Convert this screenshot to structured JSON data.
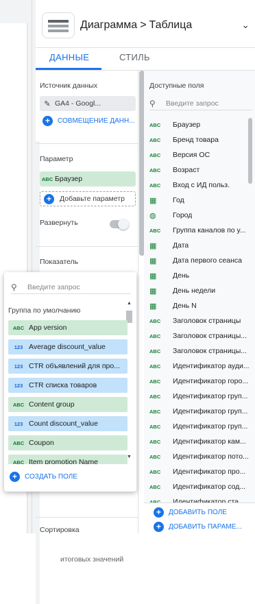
{
  "header": {
    "chart_type": "Диаграмма",
    "separator": ">",
    "chart_subtype": "Таблица"
  },
  "tabs": [
    {
      "label": "ДАННЫЕ",
      "active": true
    },
    {
      "label": "СТИЛЬ",
      "active": false
    }
  ],
  "data_panel": {
    "source_title": "Источник данных",
    "source_name": "GA4 - Googl...",
    "blend_label": "СОВМЕЩЕНИЕ ДАНН...",
    "param_title": "Параметр",
    "param_chip": "Браузер",
    "add_param": "Добавьте параметр",
    "expand_label": "Развернуть",
    "metric_title": "Показатель",
    "totals_label": "итоговых значений",
    "sort_title": "Сортировка"
  },
  "available_fields": {
    "title": "Доступные поля",
    "search_placeholder": "Введите запрос",
    "items": [
      {
        "type": "ABC",
        "label": "Браузер"
      },
      {
        "type": "ABC",
        "label": "Бренд товара"
      },
      {
        "type": "ABC",
        "label": "Версия ОС"
      },
      {
        "type": "ABC",
        "label": "Возраст"
      },
      {
        "type": "ABC",
        "label": "Вход с ИД польз."
      },
      {
        "type": "calendar",
        "label": "Год"
      },
      {
        "type": "globe",
        "label": "Город"
      },
      {
        "type": "ABC",
        "label": "Группа каналов по у..."
      },
      {
        "type": "calendar",
        "label": "Дата"
      },
      {
        "type": "calendar",
        "label": "Дата первого сеанса"
      },
      {
        "type": "calendar",
        "label": "День"
      },
      {
        "type": "calendar",
        "label": "День недели"
      },
      {
        "type": "calendar",
        "label": "День N"
      },
      {
        "type": "ABC",
        "label": "Заголовок страницы"
      },
      {
        "type": "ABC",
        "label": "Заголовок страницы..."
      },
      {
        "type": "ABC",
        "label": "Заголовок страницы..."
      },
      {
        "type": "ABC",
        "label": "Идентификатор ауди..."
      },
      {
        "type": "ABC",
        "label": "Идентификатор горо..."
      },
      {
        "type": "ABC",
        "label": "Идентификатор груп..."
      },
      {
        "type": "ABC",
        "label": "Идентификатор груп..."
      },
      {
        "type": "ABC",
        "label": "Идентификатор груп..."
      },
      {
        "type": "ABC",
        "label": "Идентификатор кам..."
      },
      {
        "type": "ABC",
        "label": "Идентификатор пото..."
      },
      {
        "type": "ABC",
        "label": "Идентификатор про..."
      },
      {
        "type": "ABC",
        "label": "Идентификатор сод..."
      },
      {
        "type": "ABC",
        "label": "Идентификатор ста..."
      }
    ],
    "add_field": "ДОБАВИТЬ ПОЛЕ",
    "add_param": "ДОБАВИТЬ ПАРАМЕ..."
  },
  "metric_picker": {
    "search_placeholder": "Введите запрос",
    "group_label": "Группа по умолчанию",
    "items": [
      {
        "type": "ABC",
        "kind": "text",
        "label": "App version"
      },
      {
        "type": "123",
        "kind": "num",
        "label": "Average discount_value"
      },
      {
        "type": "123",
        "kind": "num",
        "label": "CTR объявлений для про..."
      },
      {
        "type": "123",
        "kind": "num",
        "label": "CTR списка товаров"
      },
      {
        "type": "ABC",
        "kind": "text",
        "label": "Content group"
      },
      {
        "type": "123",
        "kind": "num",
        "label": "Count discount_value"
      },
      {
        "type": "ABC",
        "kind": "text",
        "label": "Coupon"
      },
      {
        "type": "ABC",
        "kind": "text",
        "label": "Item promotion Name"
      }
    ],
    "create_field": "СОЗДАТЬ ПОЛЕ"
  }
}
